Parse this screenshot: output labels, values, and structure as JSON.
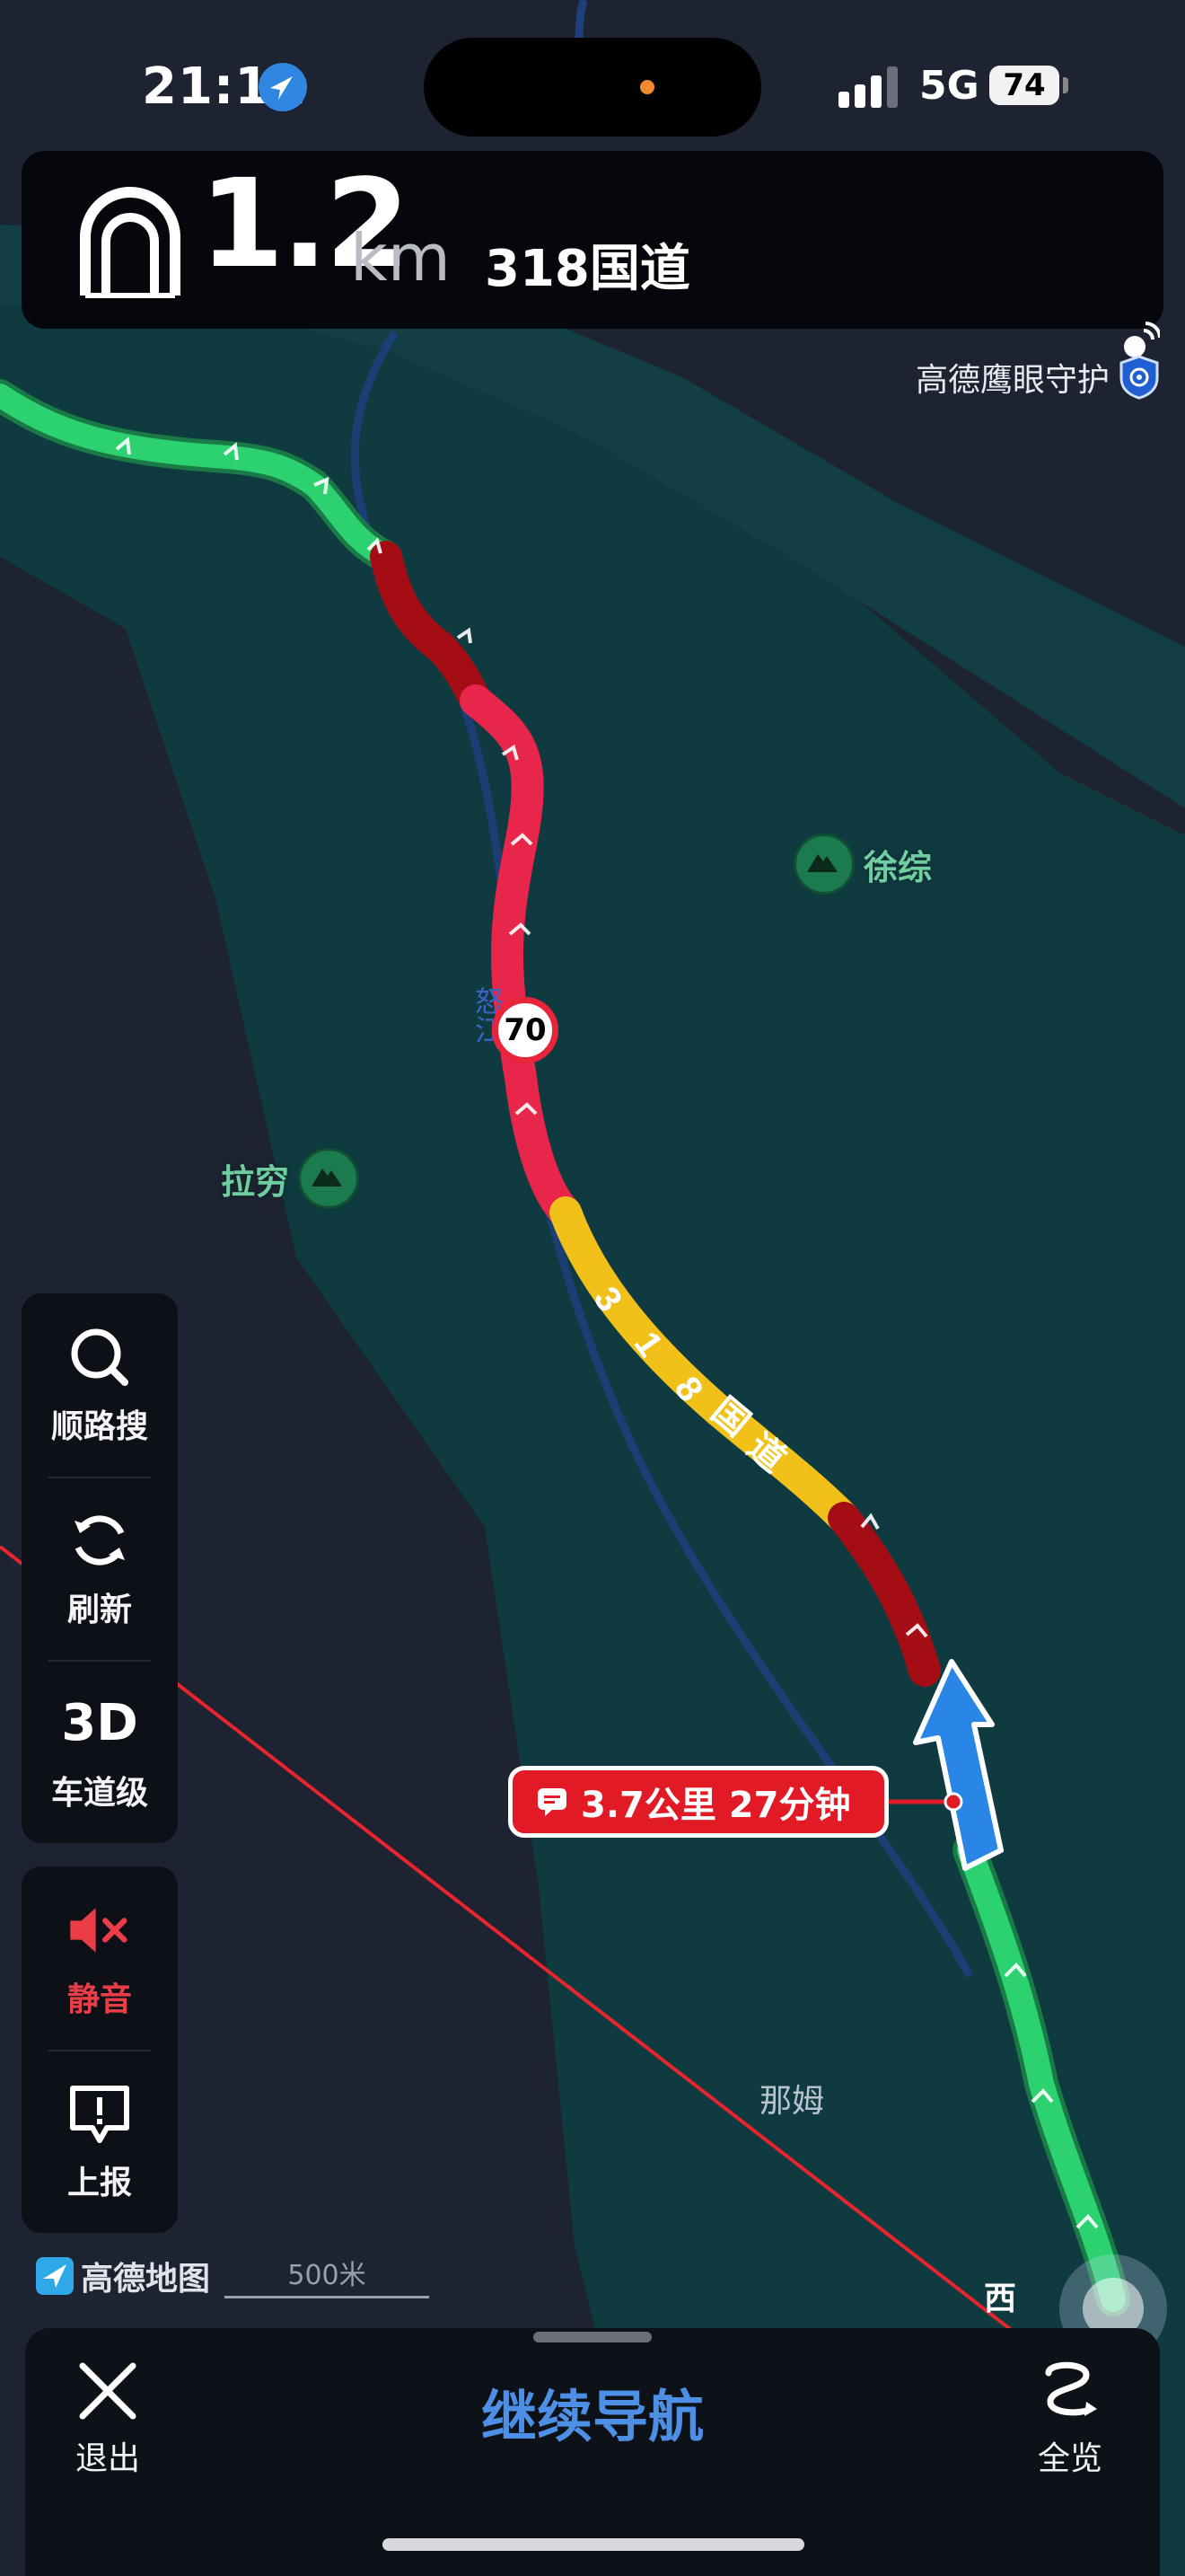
{
  "status_bar": {
    "time": "21:11",
    "network": "5G",
    "battery": "74"
  },
  "navigation": {
    "maneuver_icon": "tunnel-icon",
    "distance": "1.2",
    "distance_unit": "km",
    "road": "318国道",
    "gps_icon": "satellite-signal-icon"
  },
  "guard": {
    "label": "高德鹰眼守护",
    "icon": "shield-eye-icon"
  },
  "map": {
    "pois": [
      {
        "label": "徐综",
        "icon": "mountain-icon"
      },
      {
        "label": "拉穷",
        "icon": "mountain-icon"
      }
    ],
    "river_label": "怒江",
    "road_label": "318国道",
    "place_labels": [
      "那姆",
      "西"
    ],
    "speed_limit": "70",
    "traffic_bubble": "3.7公里 27分钟",
    "colors": {
      "smooth": "#2bd26f",
      "slow": "#f2c119",
      "congested": "#e8254a",
      "severe": "#a50d15",
      "accent": "#4c8fe4"
    }
  },
  "controls": {
    "search_label": "顺路搜",
    "refresh_label": "刷新",
    "lane_3d": "3D",
    "lane_label": "车道级",
    "mute_label": "静音",
    "report_label": "上报"
  },
  "footer": {
    "logo": "高德地图",
    "scale": "500米"
  },
  "bottom_bar": {
    "exit_label": "退出",
    "continue_label": "继续导航",
    "overview_label": "全览"
  }
}
